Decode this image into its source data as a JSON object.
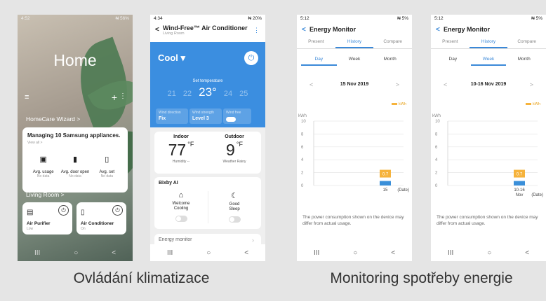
{
  "phone1": {
    "status_time": "4:52",
    "status_right": "₦ 56%",
    "title": "Home",
    "homecare_label": "HomeCare Wizard  >",
    "card": {
      "title": "Managing 10 Samsung appliances.",
      "view_all": "View all >",
      "devices": [
        {
          "name": "Avg. usage",
          "status": "No data",
          "icon": "washer-icon"
        },
        {
          "name": "Avg. door open",
          "status": "No data",
          "icon": "fridge-icon"
        },
        {
          "name": "Avg. set",
          "status": "No data",
          "icon": "aircon-icon"
        }
      ]
    },
    "living_room_label": "Living Room  >",
    "tiles": [
      {
        "name": "Air Purifier",
        "status": "Low"
      },
      {
        "name": "Air Conditioner",
        "status": "On"
      }
    ]
  },
  "phone2": {
    "status_time": "4:34",
    "status_right": "₦ 20%",
    "title": "Wind-Free™ Air Conditioner",
    "subtitle": "Living Room",
    "mode": "Cool ▾",
    "set_temp_label": "Set temperature",
    "temps": [
      "21",
      "22",
      "23°",
      "24",
      "25"
    ],
    "options": [
      {
        "label": "Wind direction",
        "value": "Fix"
      },
      {
        "label": "Wind strength",
        "value": "Level 3"
      },
      {
        "label": "Wind free",
        "value": ""
      }
    ],
    "indoor": {
      "label": "Indoor",
      "value": "77",
      "unit": "°F",
      "foot": "Humidity --"
    },
    "outdoor": {
      "label": "Outdoor",
      "value": "9",
      "unit": "°F",
      "foot": "Weather Rainy"
    },
    "bixby": {
      "title": "Bixby AI",
      "items": [
        {
          "name": "Welcome\nCooling",
          "icon": "welcome-cooling-icon"
        },
        {
          "name": "Good\nSleep",
          "icon": "good-sleep-icon"
        }
      ]
    },
    "energy_monitor": "Energy monitor"
  },
  "phone3": {
    "status_time": "5:12",
    "status_right": "₦ 5%",
    "title": "Energy Monitor",
    "tabs": [
      "Present",
      "History",
      "Compare"
    ],
    "active_tab": "History",
    "periods": [
      "Day",
      "Week",
      "Month"
    ],
    "active_period": "Day",
    "date": "15 Nov 2019",
    "legend": "kWh",
    "note": "The power consumption shown on the device may differ from actual usage."
  },
  "phone4": {
    "status_time": "5:12",
    "status_right": "₦ 5%",
    "title": "Energy Monitor",
    "tabs": [
      "Present",
      "History",
      "Compare"
    ],
    "active_tab": "History",
    "periods": [
      "Day",
      "Week",
      "Month"
    ],
    "active_period": "Week",
    "date": "10-16 Nov 2019",
    "legend": "kWh",
    "note": "The power consumption shown on the device may differ from actual usage."
  },
  "chart_data": [
    {
      "type": "bar",
      "ylabel": "kWh",
      "yticks": [
        0,
        2,
        4,
        6,
        8,
        10
      ],
      "ylim": [
        0,
        10
      ],
      "categories": [
        "15"
      ],
      "x_unit": "(Date)",
      "values": [
        0.7
      ],
      "value_labels": [
        "0.7"
      ]
    },
    {
      "type": "bar",
      "ylabel": "kWh",
      "yticks": [
        0,
        2,
        4,
        6,
        8,
        10
      ],
      "ylim": [
        0,
        10
      ],
      "categories": [
        "10-16\nNov"
      ],
      "x_unit": "(Date)",
      "values": [
        0.7
      ],
      "value_labels": [
        "0.7"
      ]
    }
  ],
  "captions": {
    "left": "Ovládání klimatizace",
    "right": "Monitoring spotřeby energie"
  },
  "nav": {
    "recent": "III",
    "home": "○",
    "back": "<"
  }
}
